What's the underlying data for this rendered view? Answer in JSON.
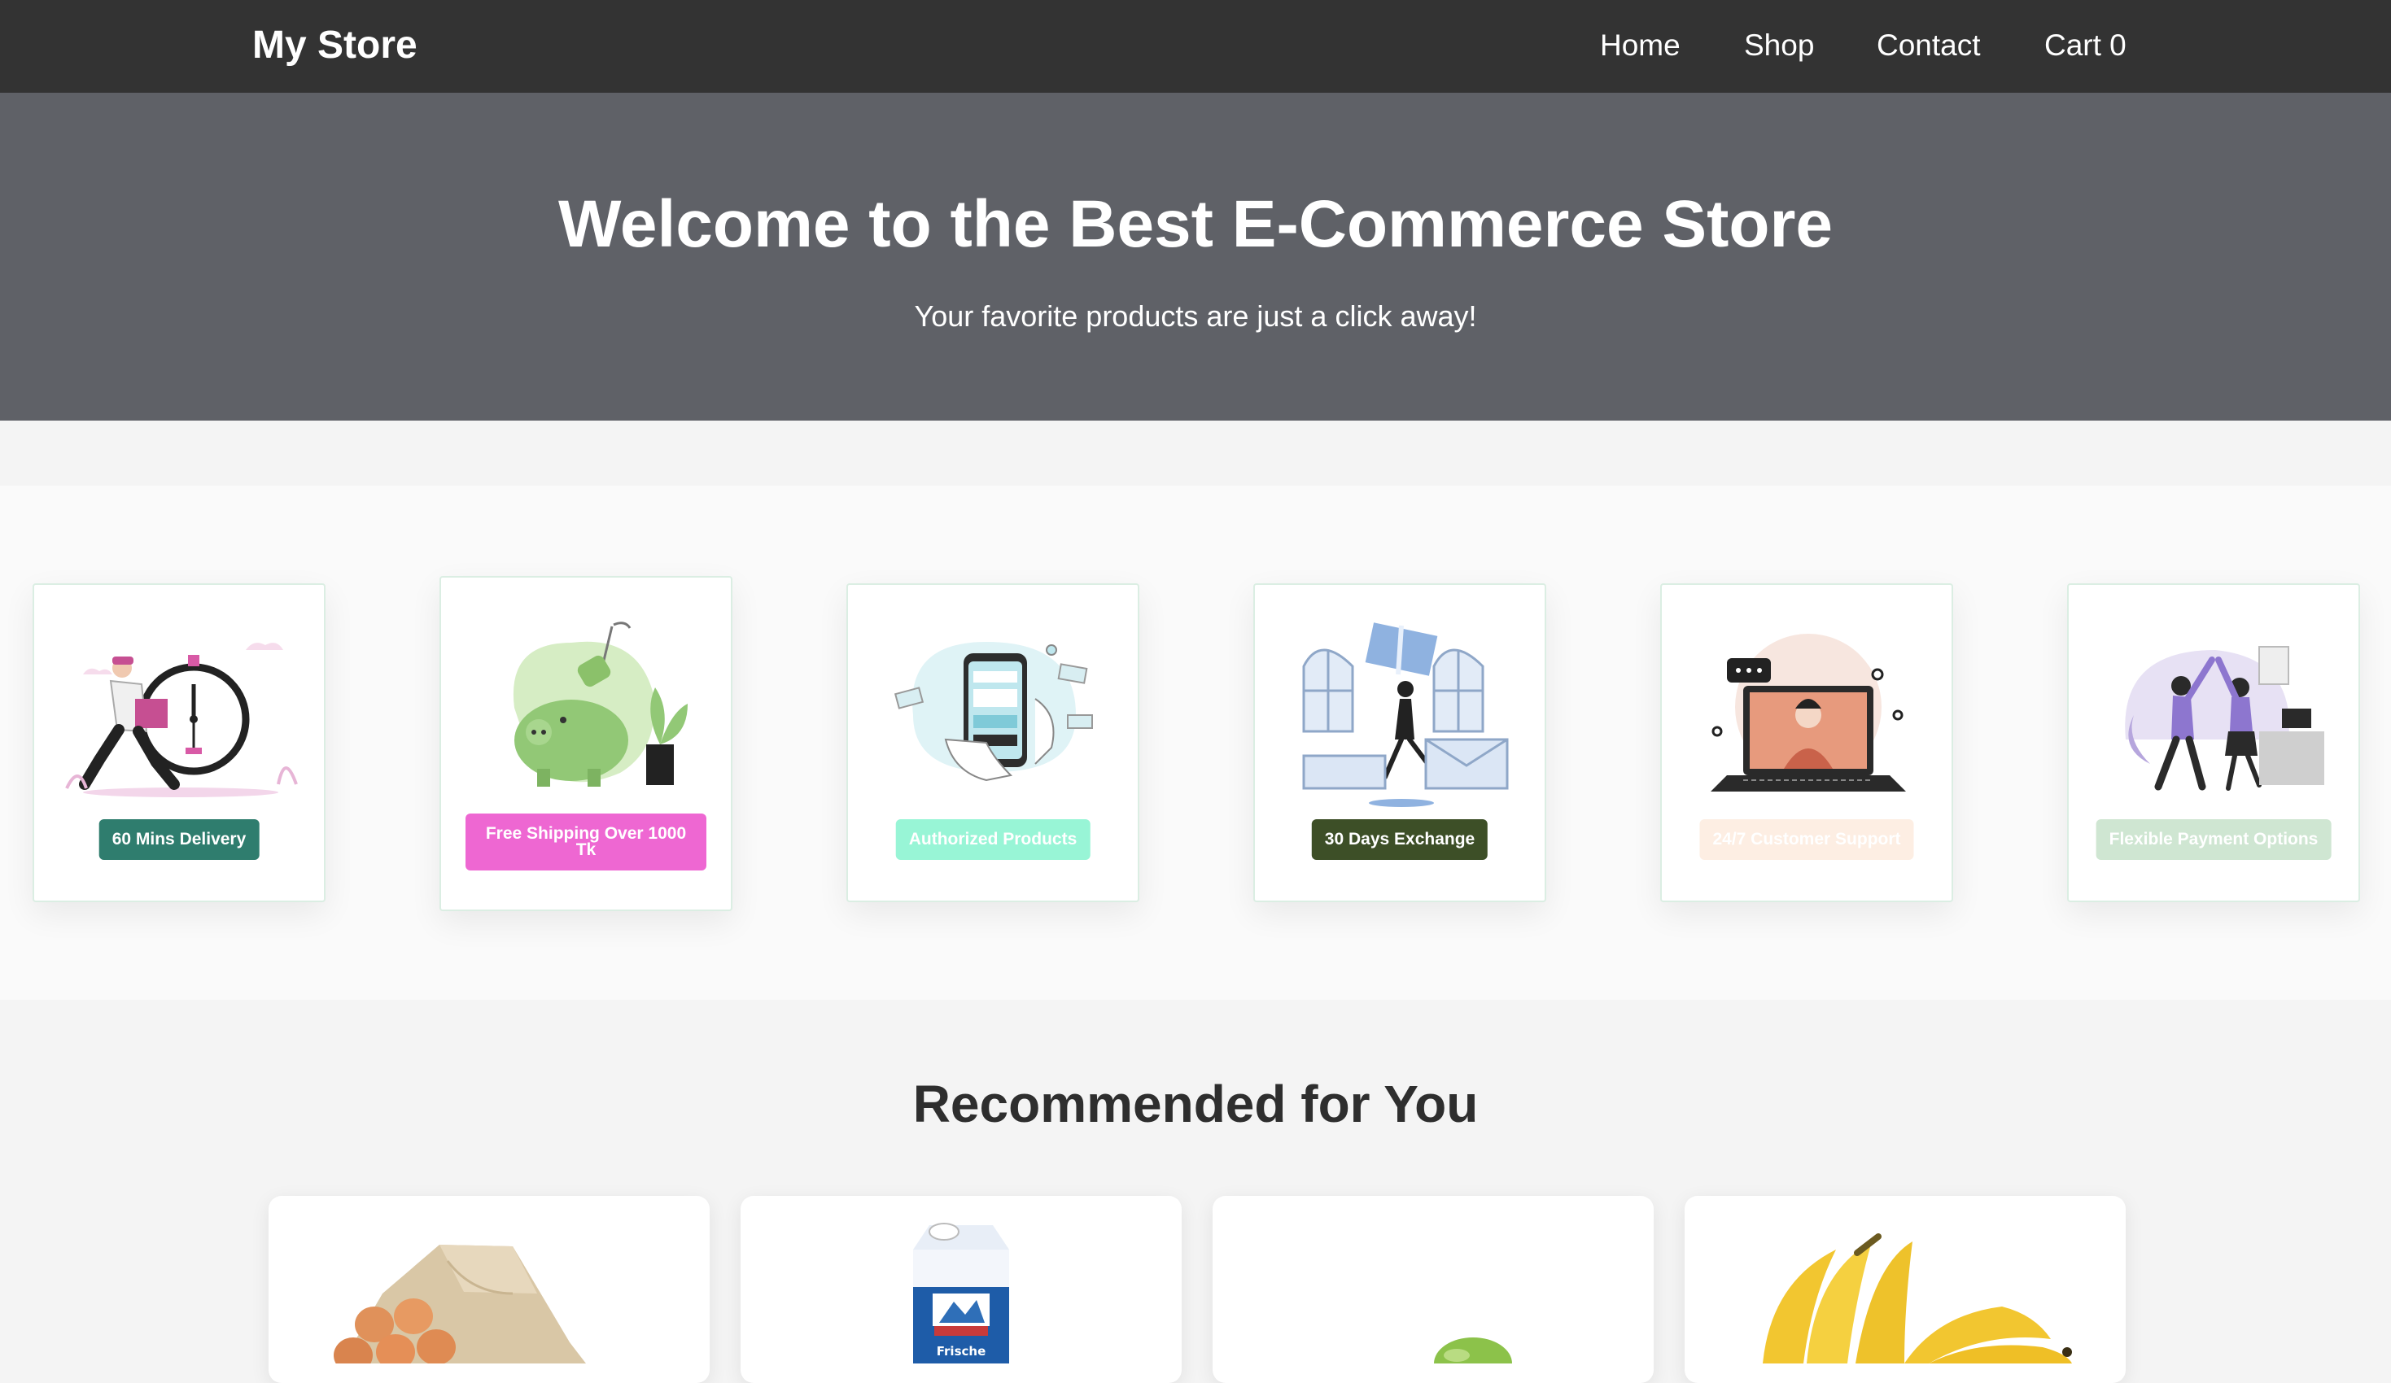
{
  "navbar": {
    "brand": "My Store",
    "links": {
      "home": "Home",
      "shop": "Shop",
      "contact": "Contact",
      "cart": "Cart 0"
    }
  },
  "hero": {
    "title": "Welcome to the Best E-Commerce Store",
    "subtitle": "Your favorite products are just a click away!"
  },
  "features": [
    {
      "label": "60 Mins Delivery",
      "badge_color": "#2f7d6e",
      "icon": "delivery-clock-icon"
    },
    {
      "label": "Free Shipping Over 1000 Tk",
      "badge_color": "#ee67d2",
      "icon": "piggy-bank-icon"
    },
    {
      "label": "Authorized Products",
      "badge_color": "#98f5d6",
      "icon": "phone-payment-icon"
    },
    {
      "label": "30 Days Exchange",
      "badge_color": "#3d4f27",
      "icon": "gift-exchange-icon"
    },
    {
      "label": "24/7 Customer Support",
      "badge_color": "#fdeee3",
      "icon": "support-laptop-icon"
    },
    {
      "label": "Flexible Payment Options",
      "badge_color": "#cfe6d2",
      "icon": "high-five-icon"
    }
  ],
  "recommended": {
    "title": "Recommended for You",
    "products": [
      {
        "icon": "eggs-tray-image"
      },
      {
        "icon": "milk-carton-image",
        "carton_text": "Frische"
      },
      {
        "icon": "green-apple-image"
      },
      {
        "icon": "bananas-image"
      }
    ]
  }
}
